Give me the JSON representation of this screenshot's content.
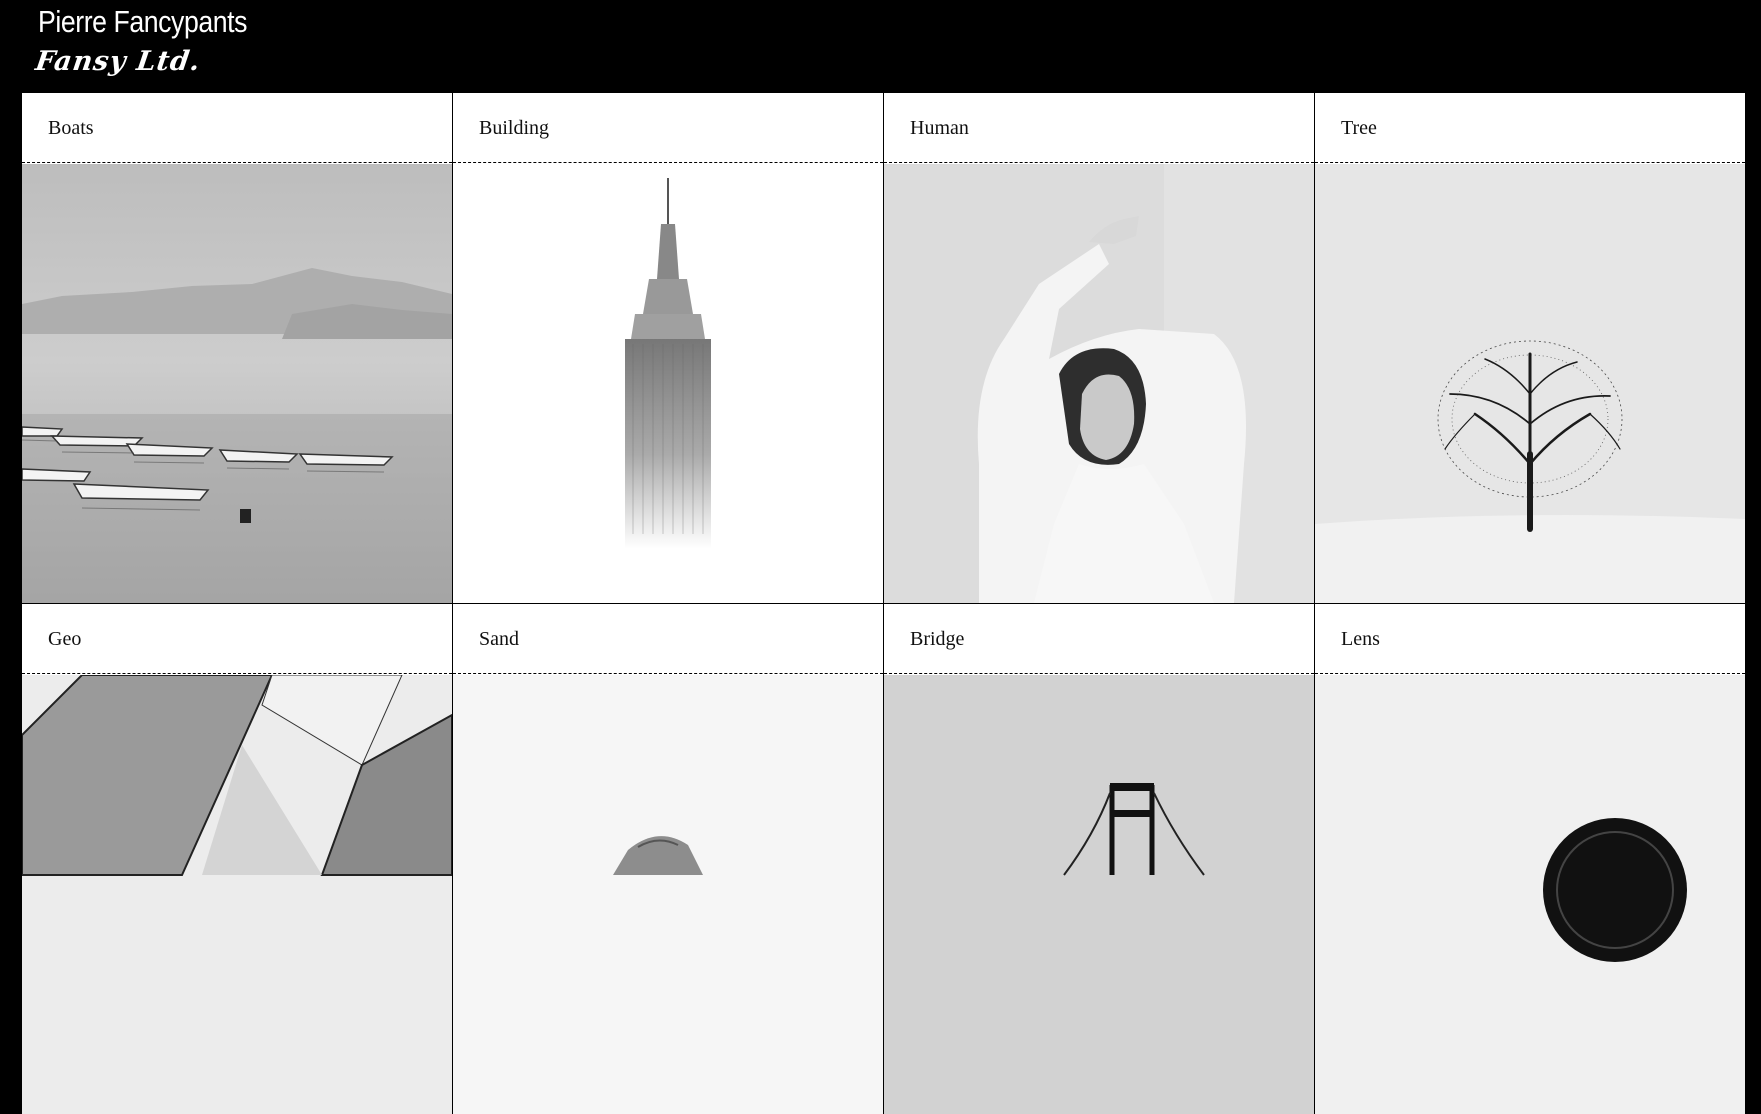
{
  "header": {
    "title": "Pierre Fancypants",
    "brand": "Fansy Ltd."
  },
  "gallery": {
    "items": [
      {
        "label": "Boats",
        "image": "boats-on-misty-lake-photo"
      },
      {
        "label": "Building",
        "image": "skyscraper-spire-photo"
      },
      {
        "label": "Human",
        "image": "woman-arms-raised-portrait-photo"
      },
      {
        "label": "Tree",
        "image": "lone-tree-in-snow-photo"
      },
      {
        "label": "Geo",
        "image": "geometric-metal-panels-photo"
      },
      {
        "label": "Sand",
        "image": "sand-dune-photo"
      },
      {
        "label": "Bridge",
        "image": "suspension-bridge-tower-photo"
      },
      {
        "label": "Lens",
        "image": "camera-lens-photo"
      }
    ]
  }
}
